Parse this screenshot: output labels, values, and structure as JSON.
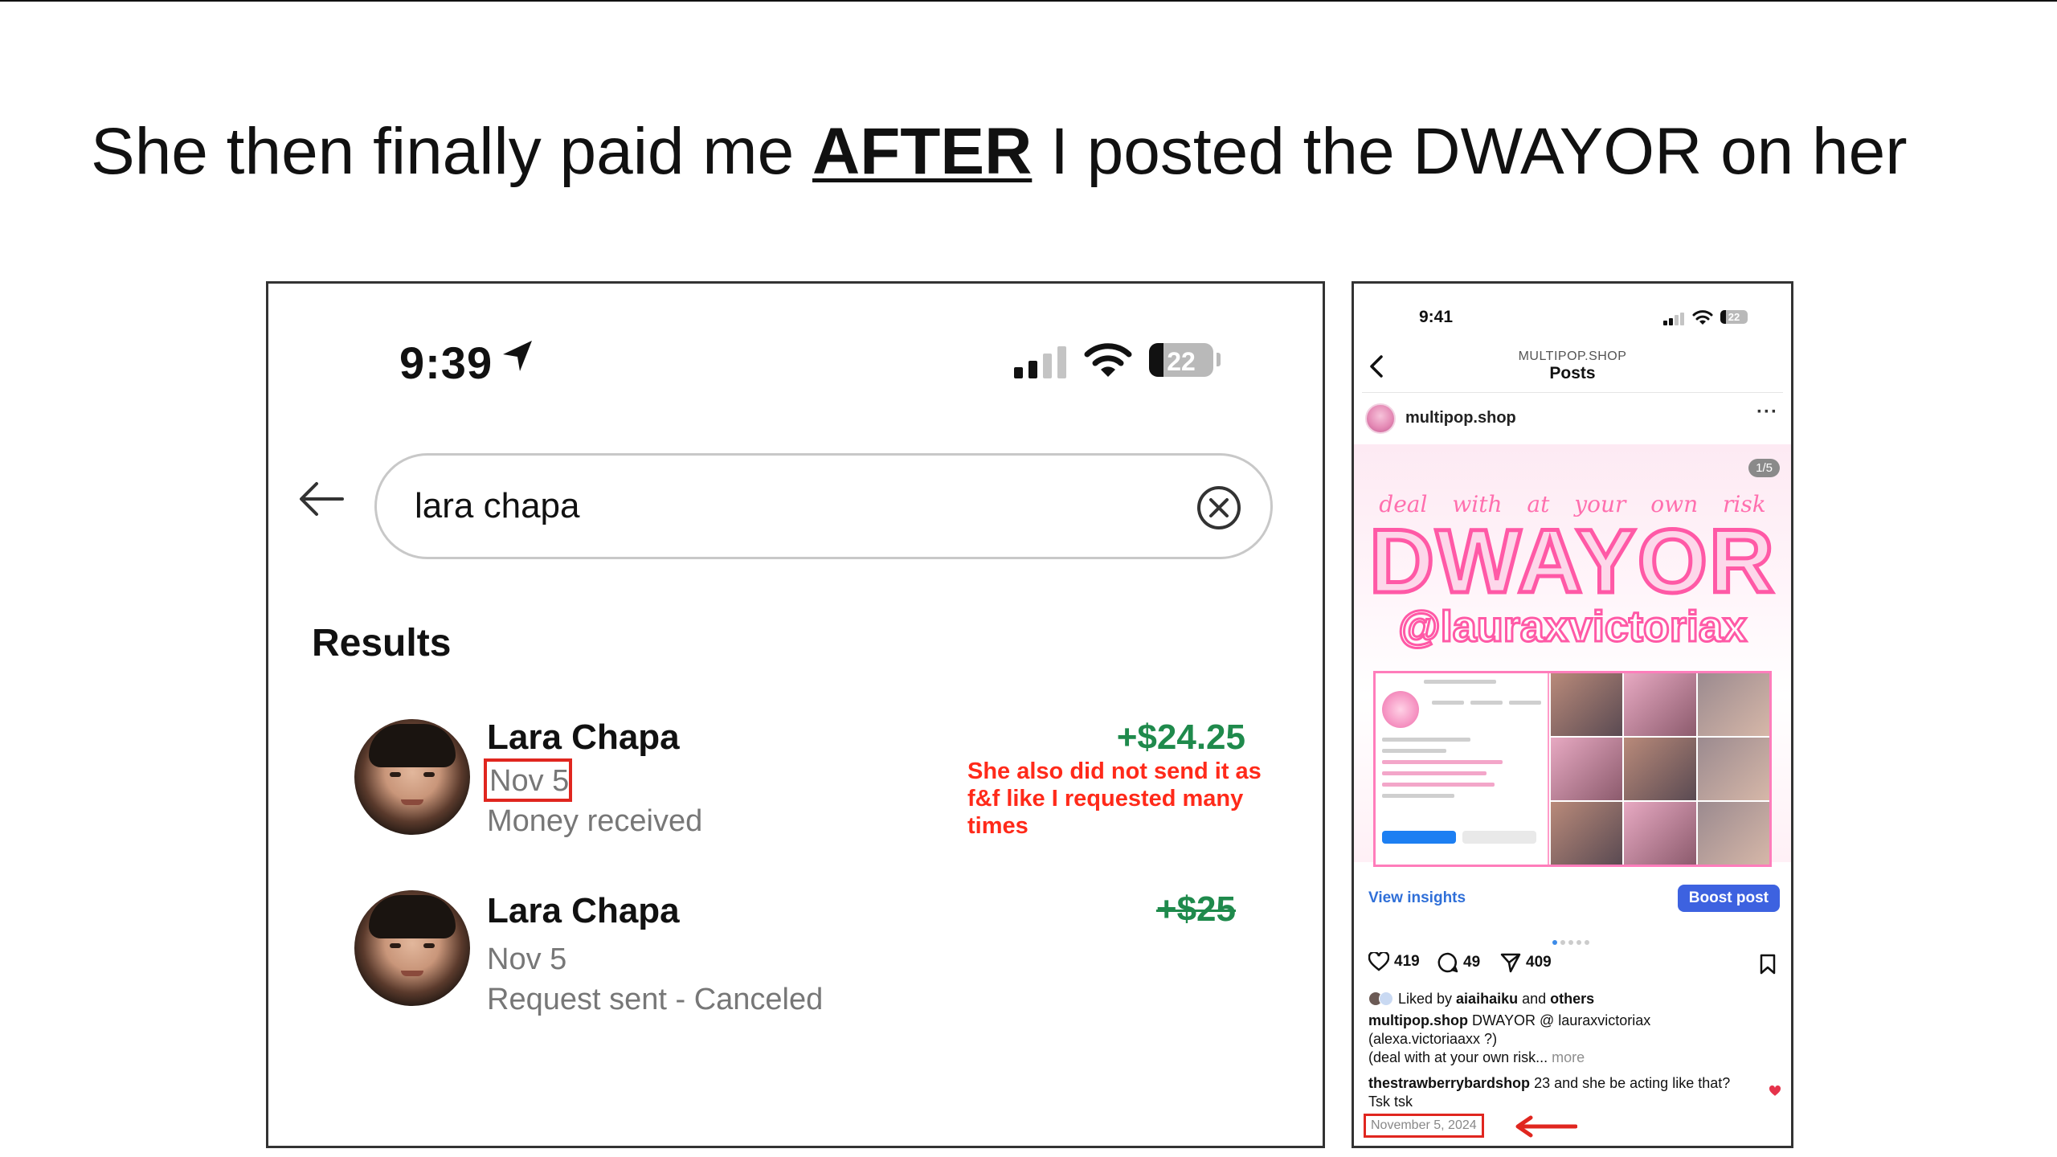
{
  "headline": {
    "pre": "She then finally paid me ",
    "emphasis": "AFTER",
    "post": " I posted the DWAYOR on her"
  },
  "left_phone": {
    "status": {
      "time": "9:39",
      "battery": "22"
    },
    "search": {
      "value": "lara chapa"
    },
    "results_heading": "Results",
    "transactions": [
      {
        "name": "Lara Chapa",
        "date": "Nov 5",
        "status": "Money received",
        "amount": "+$24.25",
        "amount_color": "#1f8a4c",
        "struck": false
      },
      {
        "name": "Lara Chapa",
        "date": "Nov 5",
        "status": "Request sent - Canceled",
        "amount": "+$25",
        "amount_color": "#1f8a4c",
        "struck": true
      }
    ],
    "annotation": "She also did not send it as f&f like I requested many times",
    "annotation_color": "#ff2a1a"
  },
  "right_phone": {
    "status": {
      "time": "9:41",
      "battery": "22"
    },
    "header": {
      "account": "MULTIPOP.SHOP",
      "title": "Posts"
    },
    "post_author": "multipop.shop",
    "post": {
      "pager": "1/5",
      "tagline": "deal with at your own risk",
      "big_text": "DWAYOR",
      "handle": "@lauraxvictoriax"
    },
    "view_insights": "View insights",
    "boost_post": "Boost post",
    "counts": {
      "likes": "419",
      "comments": "49",
      "shares": "409"
    },
    "liked_by": {
      "prefix": "Liked by ",
      "user": "aiaihaiku",
      "middle": " and ",
      "others": "others"
    },
    "caption": {
      "user": "multipop.shop",
      "line1": " DWAYOR @ lauraxvictoriax",
      "line2": "(alexa.victoriaaxx ?)",
      "line3": "(deal with at your own risk...",
      "more": " more"
    },
    "comment": {
      "user": "thestrawberrybardshop",
      "text": " 23 and she be acting like that? Tsk tsk"
    },
    "date": "November 5, 2024",
    "accent_color": "#3d62e0",
    "brand_pink": "#ff59a6"
  }
}
